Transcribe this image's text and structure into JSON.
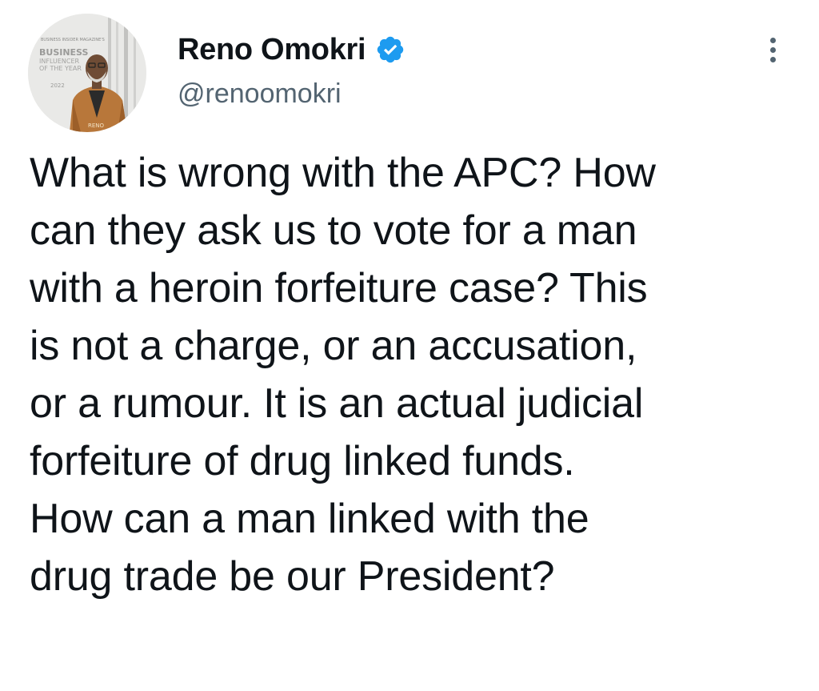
{
  "author": {
    "display_name": "Reno Omokri",
    "handle": "@renoomokri",
    "verified": true,
    "verified_icon": "verified-badge-icon",
    "verified_color": "#1d9bf0"
  },
  "avatar": {
    "badge_lines": [
      "BUSINESS",
      "INFLUENCER",
      "OF THE YEAR"
    ],
    "badge_header": "BUSINESS INSIDER MAGAZINE'S",
    "year": "2022",
    "jacket_label": "RENO"
  },
  "menu": {
    "icon": "more-options-icon"
  },
  "tweet": {
    "text": "What is wrong with the APC? How\ncan they ask us to vote for a man\nwith a heroin forfeiture case? This\nis not a charge, or an accusation,\nor a rumour. It is an actual judicial\nforfeiture of drug linked funds.\nHow can a man linked with the\ndrug trade be our President?"
  }
}
